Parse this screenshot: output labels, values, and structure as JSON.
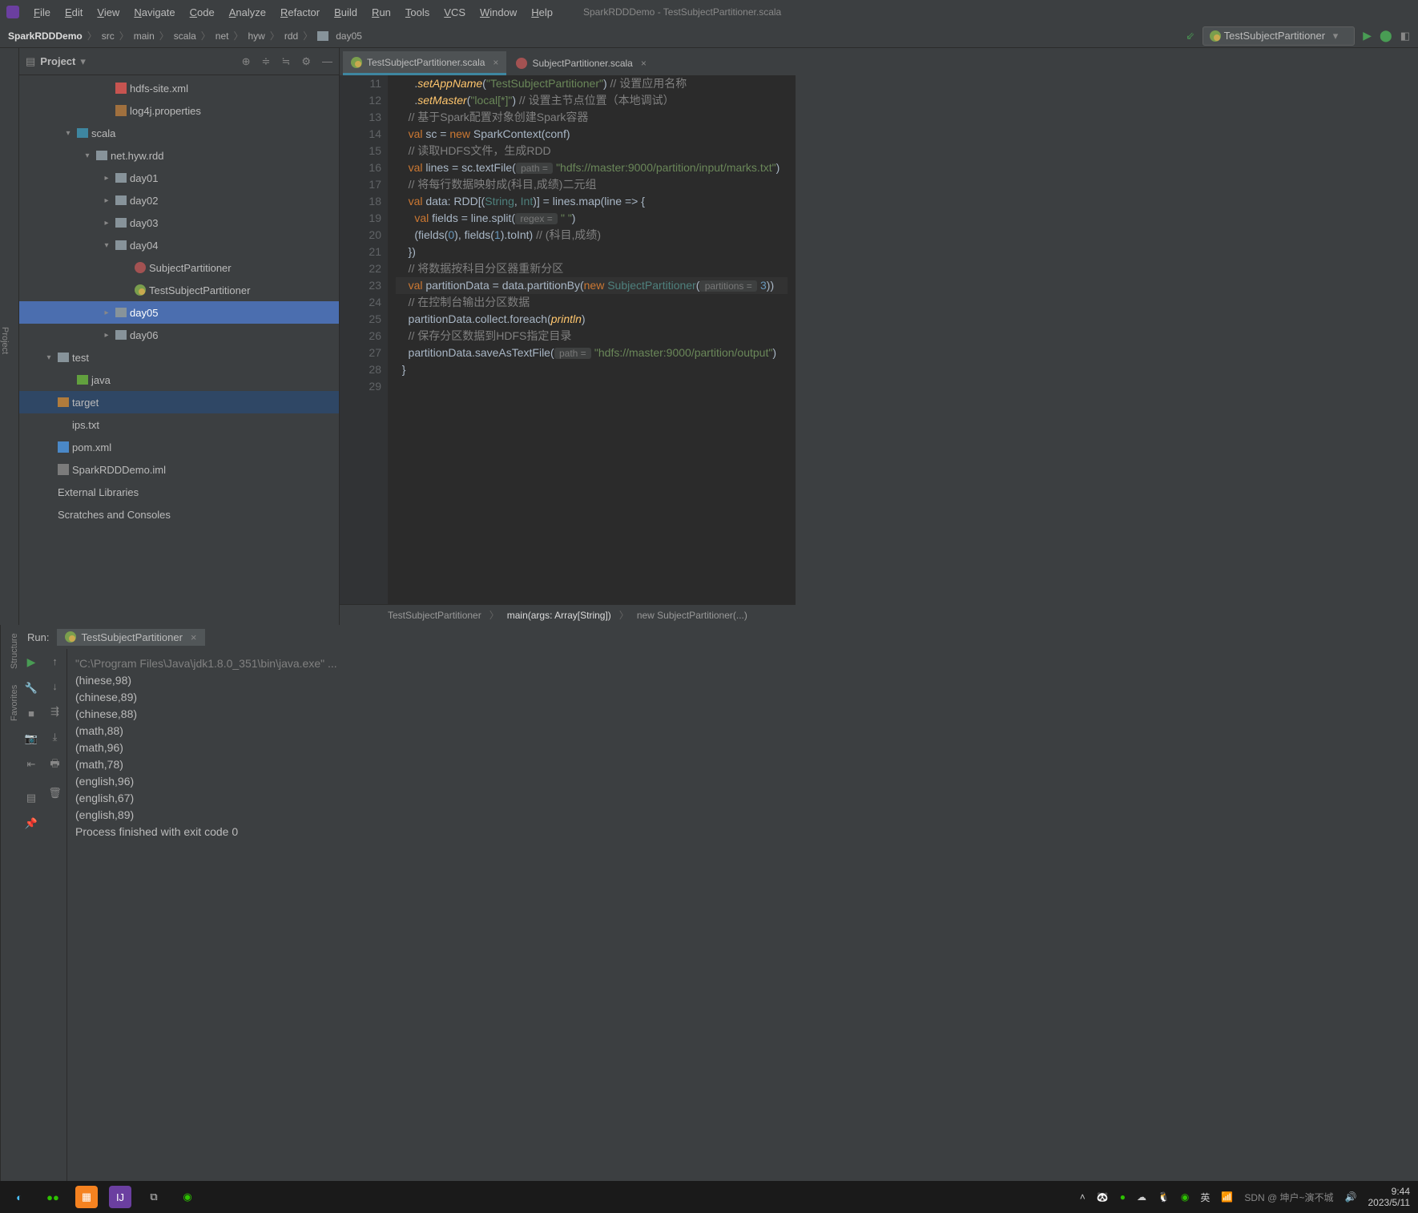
{
  "window": {
    "title": "SparkRDDDemo - TestSubjectPartitioner.scala"
  },
  "menu": [
    "File",
    "Edit",
    "View",
    "Navigate",
    "Code",
    "Analyze",
    "Refactor",
    "Build",
    "Run",
    "Tools",
    "VCS",
    "Window",
    "Help"
  ],
  "breadcrumb": [
    "SparkRDDDemo",
    "src",
    "main",
    "scala",
    "net",
    "hyw",
    "rdd",
    "day05"
  ],
  "run_config": "TestSubjectPartitioner",
  "project_panel": {
    "title": "Project"
  },
  "tree": {
    "items": [
      {
        "indent": 3,
        "icon": "xml",
        "label": "hdfs-site.xml"
      },
      {
        "indent": 3,
        "icon": "prop",
        "label": "log4j.properties"
      },
      {
        "indent": 1,
        "arrow": "down",
        "icon": "folder-blue",
        "label": "scala"
      },
      {
        "indent": 2,
        "arrow": "down",
        "icon": "folder",
        "label": "net.hyw.rdd"
      },
      {
        "indent": 3,
        "arrow": "right",
        "icon": "folder",
        "label": "day01"
      },
      {
        "indent": 3,
        "arrow": "right",
        "icon": "folder",
        "label": "day02"
      },
      {
        "indent": 3,
        "arrow": "right",
        "icon": "folder",
        "label": "day03"
      },
      {
        "indent": 3,
        "arrow": "down",
        "icon": "folder",
        "label": "day04"
      },
      {
        "indent": 4,
        "icon": "scala",
        "label": "SubjectPartitioner"
      },
      {
        "indent": 4,
        "icon": "scala-obj",
        "label": "TestSubjectPartitioner"
      },
      {
        "indent": 3,
        "arrow": "right",
        "icon": "folder",
        "label": "day05",
        "selected": true
      },
      {
        "indent": 3,
        "arrow": "right",
        "icon": "folder",
        "label": "day06"
      },
      {
        "indent": 0,
        "arrow": "down",
        "icon": "folder",
        "label": "test"
      },
      {
        "indent": 1,
        "icon": "folder-green",
        "label": "java"
      },
      {
        "indent": 0,
        "icon": "folder-orange",
        "label": "target",
        "hl": true
      },
      {
        "indent": 0,
        "icon": "txt",
        "label": "ips.txt"
      },
      {
        "indent": 0,
        "icon": "m",
        "label": "pom.xml"
      },
      {
        "indent": 0,
        "icon": "iml",
        "label": "SparkRDDDemo.iml"
      },
      {
        "indent": -1,
        "label": "External Libraries"
      },
      {
        "indent": -1,
        "label": "Scratches and Consoles"
      }
    ]
  },
  "editor_tabs": [
    {
      "label": "TestSubjectPartitioner.scala",
      "icon": "scala-obj",
      "active": true
    },
    {
      "label": "SubjectPartitioner.scala",
      "icon": "scala",
      "active": false
    }
  ],
  "code": {
    "first_line": 11,
    "lines": [
      {
        "n": 11,
        "tokens": [
          [
            "",
            "      ."
          ],
          [
            "fn",
            "setAppName"
          ],
          [
            "",
            "("
          ],
          [
            "str",
            "\"TestSubjectPartitioner\""
          ],
          [
            "",
            ") "
          ],
          [
            "cmt",
            "// 设置应用名称"
          ]
        ]
      },
      {
        "n": 12,
        "tokens": [
          [
            "",
            "      ."
          ],
          [
            "fn",
            "setMaster"
          ],
          [
            "",
            "("
          ],
          [
            "str",
            "\"local[*]\""
          ],
          [
            "",
            ") "
          ],
          [
            "cmt",
            "// 设置主节点位置（本地调试）"
          ]
        ]
      },
      {
        "n": 13,
        "tokens": [
          [
            "",
            "    "
          ],
          [
            "cmt",
            "// 基于Spark配置对象创建Spark容器"
          ]
        ]
      },
      {
        "n": 14,
        "tokens": [
          [
            "",
            "    "
          ],
          [
            "kw",
            "val"
          ],
          [
            "",
            " sc = "
          ],
          [
            "kw",
            "new"
          ],
          [
            "",
            " SparkContext(conf)"
          ]
        ]
      },
      {
        "n": 15,
        "tokens": [
          [
            "",
            "    "
          ],
          [
            "cmt",
            "// 读取HDFS文件，生成RDD"
          ]
        ]
      },
      {
        "n": 16,
        "tokens": [
          [
            "",
            "    "
          ],
          [
            "kw",
            "val"
          ],
          [
            "",
            " lines = sc.textFile("
          ],
          [
            "hinted",
            " path = "
          ],
          [
            "",
            " "
          ],
          [
            "str",
            "\"hdfs://master:9000/partition/input/marks.txt\""
          ],
          [
            "",
            ")"
          ]
        ]
      },
      {
        "n": 17,
        "tokens": [
          [
            "",
            "    "
          ],
          [
            "cmt",
            "// 将每行数据映射成(科目,成绩)二元组"
          ]
        ]
      },
      {
        "n": 18,
        "tokens": [
          [
            "",
            "    "
          ],
          [
            "kw",
            "val"
          ],
          [
            "",
            " data: RDD[("
          ],
          [
            "type",
            "String"
          ],
          [
            "",
            ", "
          ],
          [
            "type",
            "Int"
          ],
          [
            "",
            ")] = lines.map(line => {"
          ]
        ]
      },
      {
        "n": 19,
        "tokens": [
          [
            "",
            "      "
          ],
          [
            "kw",
            "val"
          ],
          [
            "",
            " fields = line.split("
          ],
          [
            "hinted",
            " regex = "
          ],
          [
            "",
            " "
          ],
          [
            "str",
            "\" \""
          ],
          [
            "",
            ")"
          ]
        ]
      },
      {
        "n": 20,
        "tokens": [
          [
            "",
            "      (fields("
          ],
          [
            "num",
            "0"
          ],
          [
            "",
            "), fields("
          ],
          [
            "num",
            "1"
          ],
          [
            "",
            ").toInt) "
          ],
          [
            "cmt",
            "// (科目,成绩)"
          ]
        ]
      },
      {
        "n": 21,
        "tokens": [
          [
            "",
            "    })"
          ]
        ]
      },
      {
        "n": 22,
        "tokens": [
          [
            "",
            "    "
          ],
          [
            "cmt",
            "// 将数据按科目分区器重新分区"
          ]
        ]
      },
      {
        "n": 23,
        "hl": true,
        "tokens": [
          [
            "",
            "    "
          ],
          [
            "kw",
            "val"
          ],
          [
            "",
            " partitionData = data.partitionBy("
          ],
          [
            "kw",
            "new"
          ],
          [
            "",
            " "
          ],
          [
            "type",
            "SubjectPartitioner"
          ],
          [
            "",
            "("
          ],
          [
            "hinted",
            " partitions = "
          ],
          [
            "",
            " "
          ],
          [
            "num",
            "3"
          ],
          [
            "",
            "))"
          ]
        ]
      },
      {
        "n": 24,
        "tokens": [
          [
            "",
            "    "
          ],
          [
            "cmt",
            "// 在控制台输出分区数据"
          ]
        ]
      },
      {
        "n": 25,
        "tokens": [
          [
            "",
            "    partitionData.collect.foreach("
          ],
          [
            "fn",
            "println"
          ],
          [
            "",
            ")"
          ]
        ]
      },
      {
        "n": 26,
        "tokens": [
          [
            "",
            "    "
          ],
          [
            "cmt",
            "// 保存分区数据到HDFS指定目录"
          ]
        ]
      },
      {
        "n": 27,
        "tokens": [
          [
            "",
            "    partitionData.saveAsTextFile("
          ],
          [
            "hinted",
            " path = "
          ],
          [
            "",
            " "
          ],
          [
            "str",
            "\"hdfs://master:9000/partition/output\""
          ],
          [
            "",
            ")"
          ]
        ]
      },
      {
        "n": 28,
        "tokens": [
          [
            "",
            "  }"
          ]
        ]
      },
      {
        "n": 29,
        "cut": true,
        "tokens": [
          [
            "",
            ""
          ]
        ]
      }
    ]
  },
  "editor_crumbs": [
    "TestSubjectPartitioner",
    "main(args: Array[String])",
    "new SubjectPartitioner(...)"
  ],
  "run": {
    "label": "Run:",
    "tab": "TestSubjectPartitioner",
    "output": [
      {
        "cls": "cmd",
        "text": "\"C:\\Program Files\\Java\\jdk1.8.0_351\\bin\\java.exe\" ..."
      },
      {
        "text": "(hinese,98)"
      },
      {
        "text": "(chinese,89)"
      },
      {
        "text": "(chinese,88)"
      },
      {
        "text": "(math,88)"
      },
      {
        "text": "(math,96)"
      },
      {
        "text": "(math,78)"
      },
      {
        "text": "(english,96)"
      },
      {
        "text": "(english,67)"
      },
      {
        "text": "(english,89)"
      },
      {
        "text": ""
      },
      {
        "text": "Process finished with exit code 0"
      }
    ]
  },
  "left_tabs": {
    "top": "Project",
    "bottom": [
      "Structure",
      "Favorites"
    ]
  },
  "taskbar": {
    "lang": "英",
    "time": "9:44",
    "date": "2023/5/11",
    "watermark": "SDN @ 坤户~演不城"
  }
}
